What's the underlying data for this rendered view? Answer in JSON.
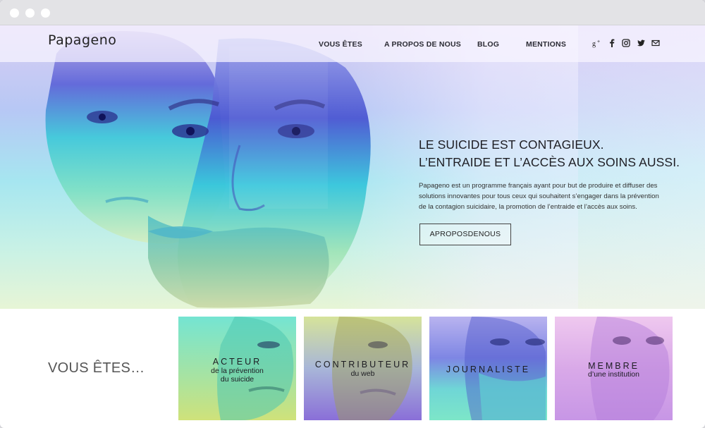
{
  "brand": {
    "logo_text": "Papageno"
  },
  "nav": {
    "items": [
      "VOUS ÊTES",
      "A PROPOS DE NOUS",
      "BLOG",
      "MENTIONS"
    ],
    "social": [
      "google-plus-icon",
      "facebook-icon",
      "instagram-icon",
      "twitter-icon",
      "mail-icon"
    ]
  },
  "hero": {
    "headline_1": "LE SUICIDE EST CONTAGIEUX.",
    "headline_2": "L’ENTRAIDE ET L’ACCÈS AUX SOINS AUSSI.",
    "intro": "Papageno est un programme français ayant pour but de produire et diffuser des solutions innovantes pour tous ceux qui souhaitent s’engager dans la prévention de la contagion suicidaire, la promotion de l’entraide et l’accès aux soins.",
    "button_label": "APROPOSDENOUS"
  },
  "audience": {
    "heading": "VOUS ÊTES…",
    "tiles": [
      {
        "title": "ACTEUR",
        "sub1": "de la prévention",
        "sub2": "du suicide"
      },
      {
        "title": "CONTRIBUTEUR",
        "sub1": "du web",
        "sub2": ""
      },
      {
        "title": "JOURNALISTE",
        "sub1": "",
        "sub2": ""
      },
      {
        "title": "MEMBRE",
        "sub1": "d’une institution",
        "sub2": ""
      }
    ]
  },
  "colors": {
    "hero_top": "#d9cdf2",
    "hero_mid": "#a6e6f0",
    "hero_bottom": "#e7f5d6",
    "face_blue": "#5a63d8",
    "face_cyan": "#3fd4d6",
    "text_dark": "#1e1e24"
  }
}
